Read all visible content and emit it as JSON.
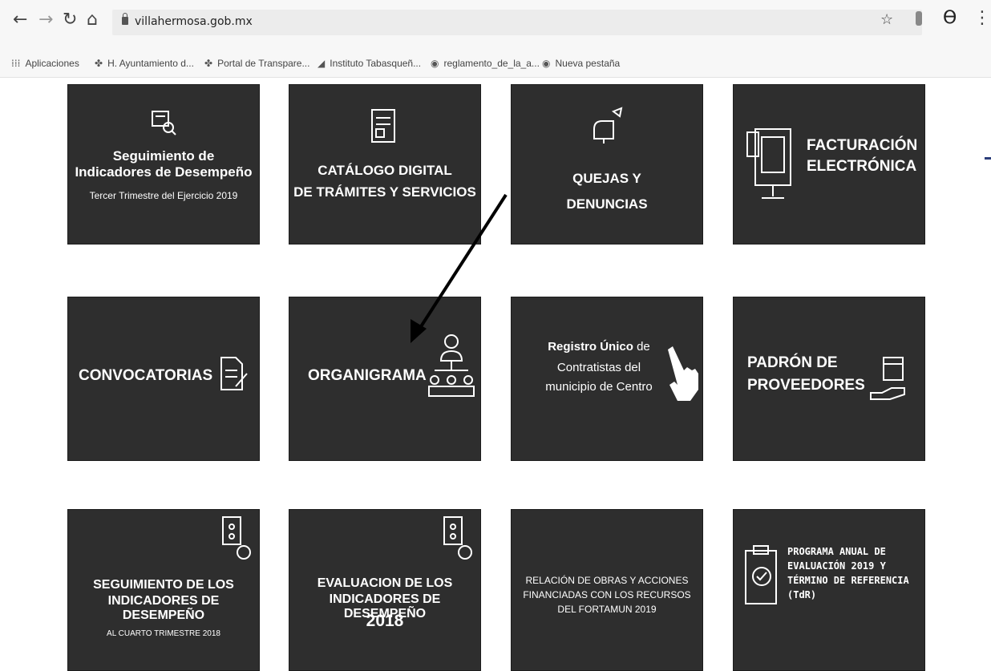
{
  "browser": {
    "url": "villahermosa.gob.mx",
    "bookmarks": [
      "Aplicaciones",
      "H. Ayuntamiento d...",
      "Portal de Transpare...",
      "Instituto Tabasqueñ...",
      "reglamento_de_la_a...",
      "Nueva pestaña"
    ]
  },
  "tiles": {
    "r1c1": {
      "line1": "Seguimiento de",
      "line2": "Indicadores de Desempeño",
      "sub": "Tercer Trimestre del Ejercicio 2019"
    },
    "r1c2": {
      "line1": "CATÁLOGO DIGITAL",
      "line2": "DE TRÁMITES Y SERVICIOS"
    },
    "r1c3": {
      "line1": "QUEJAS Y",
      "line2": "DENUNCIAS"
    },
    "r1c4": {
      "line1": "FACTURACIÓN",
      "line2": "ELECTRÓNICA"
    },
    "r2c1": {
      "title": "CONVOCATORIAS"
    },
    "r2c2": {
      "title": "ORGANIGRAMA"
    },
    "r2c3": {
      "bold": "Registro Único",
      "rest1": "de",
      "line2": "Contratistas del",
      "line3": "municipio de Centro"
    },
    "r2c4": {
      "line1": "PADRÓN DE",
      "line2": "PROVEEDORES"
    },
    "r3c1": {
      "line1": "SEGUIMIENTO DE LOS",
      "line2": "INDICADORES DE DESEMPEÑO",
      "sub": "AL CUARTO TRIMESTRE 2018"
    },
    "r3c2": {
      "line1": "EVALUACION DE LOS",
      "line2": "INDICADORES DE DESEMPEÑO",
      "line3": "2018"
    },
    "r3c3": {
      "line1": "RELACIÓN DE OBRAS Y ACCIONES",
      "line2": "FINANCIADAS CON LOS RECURSOS",
      "line3": "DEL FORTAMUN 2019"
    },
    "r3c4": {
      "line1": "PROGRAMA ANUAL DE",
      "line2": "EVALUACIÓN 2019 Y",
      "line3": "TÉRMINO DE REFERENCIA",
      "line4": "(TdR)"
    }
  }
}
